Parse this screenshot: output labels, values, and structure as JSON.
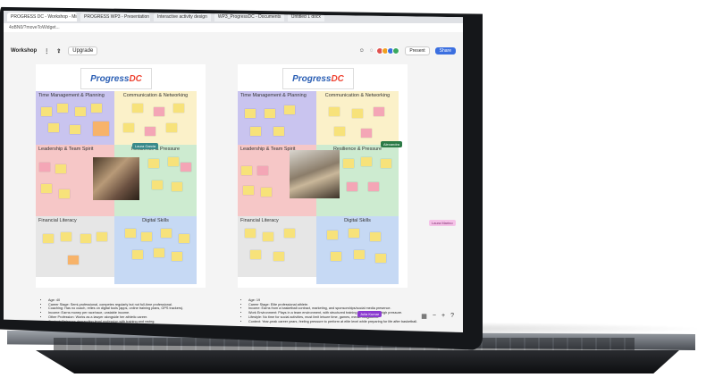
{
  "browser": {
    "tabs": [
      {
        "label": "PROGRESS DC - Workshop - Miro",
        "active": true
      },
      {
        "label": "PROGRESS WP3 - Presentation"
      },
      {
        "label": "Interactive activity design"
      },
      {
        "label": "WP3_ProgressDC - Documents"
      },
      {
        "label": "Untitled 1 docx"
      }
    ],
    "address": "4oBN0/?moveToWidget..."
  },
  "toolbar": {
    "board_name": "Workshop",
    "upgrade_label": "Upgrade",
    "present_label": "Present",
    "share_label": "Share",
    "avatar_colors": [
      "#e0524f",
      "#f0a020",
      "#3b6fe0",
      "#3aa860"
    ]
  },
  "boards": [
    {
      "logo": "ProgressDC",
      "sections": {
        "tm": "Time Management & Planning",
        "cn": "Communication & Networking",
        "lt": "Leadership & Team Spirit",
        "rp": "Resilience & Pressure",
        "fl": "Financial Literacy",
        "ds": "Digital Skills"
      },
      "persona": [
        "Age: 40",
        "Career Stage: Semi-professional, competes regularly but not full-time professional.",
        "Coaching: Has no coach, relies on digital tools (apps, online training plans, GPS trackers).",
        "Income: Earns money per race/race, unstable income.",
        "Other Profession: Works as a lawyer alongside her athletic career.",
        "Context: Balances demanding legal profession with training and racing."
      ]
    },
    {
      "logo": "ProgressDC",
      "sections": {
        "tm": "Time Management & Planning",
        "cn": "Communication & Networking",
        "lt": "Leadership & Team Spirit",
        "rp": "Resilience & Pressure",
        "fl": "Financial Literacy",
        "ds": "Digital Skills"
      },
      "persona": [
        "Age: 19",
        "Career Stage: Elite professional athlete.",
        "Income: Earns from a basketball contract, marketing, and sponsorships/social media presence.",
        "Work Environment: Plays in a team environment, with structured training schedules and high pressure.",
        "Lifestyle: No time for social activities, must limit leisure time, games, media obligations.",
        "Context: Year-peak career years, feeling pressure to perform at elite level while preparing for life after basketball."
      ]
    }
  ],
  "cursor_tags": {
    "tag1": "Alexandra",
    "tag2": "Laura Garcia",
    "tag3": "Julia Kumar",
    "tag4": "Laura Marino"
  }
}
